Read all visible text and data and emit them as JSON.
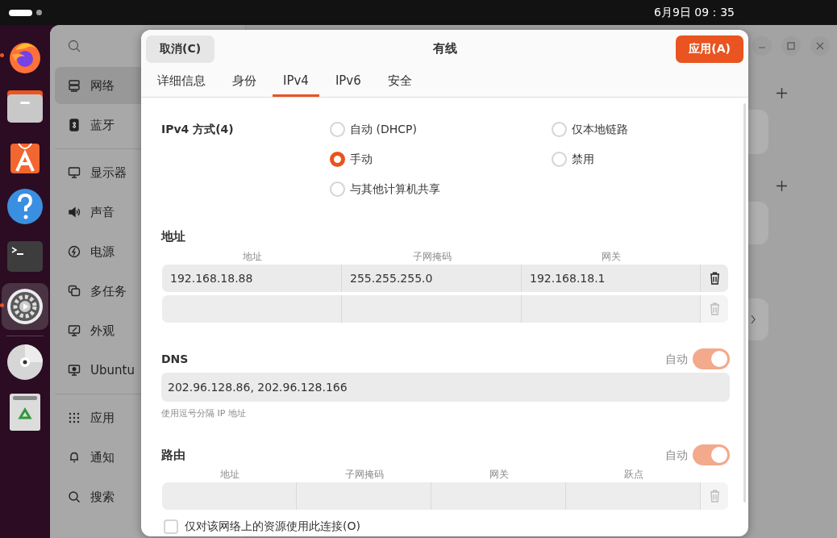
{
  "top_bar": {
    "clock": "6月9日 09：35"
  },
  "dock": [
    {
      "running": true,
      "selected": false
    },
    {
      "running": false,
      "selected": false
    },
    {
      "running": false,
      "selected": false
    },
    {
      "running": false,
      "selected": false
    },
    {
      "running": false,
      "selected": false
    },
    {
      "running": true,
      "selected": true
    },
    {
      "running": false,
      "selected": false
    },
    {
      "running": false,
      "selected": false
    }
  ],
  "sidebar": {
    "groups": [
      [
        {
          "label": "网络",
          "selected": true
        },
        {
          "label": "蓝牙",
          "selected": false
        }
      ],
      [
        {
          "label": "显示器",
          "selected": false
        },
        {
          "label": "声音",
          "selected": false
        },
        {
          "label": "电源",
          "selected": false
        },
        {
          "label": "多任务",
          "selected": false
        },
        {
          "label": "外观",
          "selected": false
        },
        {
          "label": "Ubuntu",
          "selected": false
        }
      ],
      [
        {
          "label": "应用",
          "selected": false
        },
        {
          "label": "通知",
          "selected": false
        },
        {
          "label": "搜索",
          "selected": false
        }
      ]
    ]
  },
  "dialog": {
    "title": "有线",
    "cancel": "取消(C)",
    "apply": "应用(A)",
    "tabs": [
      {
        "label": "详细信息",
        "selected": false
      },
      {
        "label": "身份",
        "selected": false
      },
      {
        "label": "IPv4",
        "selected": true
      },
      {
        "label": "IPv6",
        "selected": false
      },
      {
        "label": "安全",
        "selected": false
      }
    ],
    "method": {
      "label": "IPv4 方式(4)",
      "options": [
        {
          "label": "自动 (DHCP)",
          "selected": false
        },
        {
          "label": "手动",
          "selected": true
        },
        {
          "label": "与其他计算机共享",
          "selected": false
        },
        {
          "label": "仅本地链路",
          "selected": false
        },
        {
          "label": "禁用",
          "selected": false
        }
      ]
    },
    "addresses": {
      "title": "地址",
      "columns": [
        "地址",
        "子网掩码",
        "网关"
      ],
      "rows": [
        {
          "values": [
            "192.168.18.88",
            "255.255.255.0",
            "192.168.18.1"
          ],
          "removable": true
        },
        {
          "removable": false
        }
      ]
    },
    "dns": {
      "title": "DNS",
      "auto_label": "自动",
      "auto": true,
      "value": "202.96.128.86, 202.96.128.166",
      "hint": "使用逗号分隔 IP 地址"
    },
    "routes": {
      "title": "路由",
      "auto_label": "自动",
      "auto": true,
      "columns": [
        "地址",
        "子网掩码",
        "网关",
        "跃点"
      ],
      "rows": [
        {
          "removable": false
        }
      ]
    },
    "only_local": {
      "label": "仅对该网络上的资源使用此连接(O)",
      "checked": false
    }
  }
}
